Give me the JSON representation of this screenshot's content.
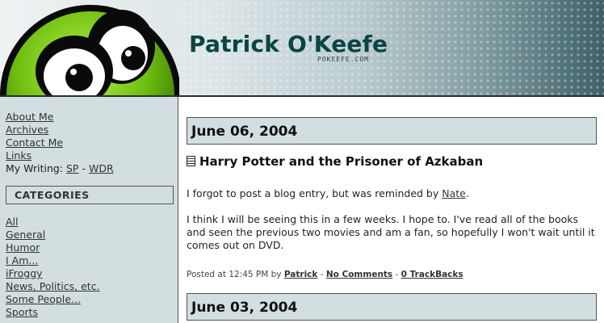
{
  "header": {
    "title": "Patrick O'Keefe",
    "domain": "POKEEFE.COM"
  },
  "sidebar": {
    "links": [
      {
        "label": "About Me"
      },
      {
        "label": "Archives"
      },
      {
        "label": "Contact Me"
      },
      {
        "label": "Links"
      }
    ],
    "writing": {
      "prefix": "My Writing:",
      "sp": "SP",
      "sep": "-",
      "wdr": "WDR"
    },
    "categories_heading": "CATEGORIES",
    "categories": [
      {
        "label": "All"
      },
      {
        "label": "General"
      },
      {
        "label": "Humor"
      },
      {
        "label": "I Am..."
      },
      {
        "label": "iFroggy"
      },
      {
        "label": "News, Politics, etc."
      },
      {
        "label": "Some People..."
      },
      {
        "label": "Sports"
      }
    ]
  },
  "main": {
    "dates": [
      "June 06, 2004",
      "June 03, 2004"
    ],
    "entry": {
      "title": "Harry Potter and the Prisoner of Azkaban",
      "para1_text": "I forgot to post a blog entry, but was reminded by ",
      "para1_link": "Nate",
      "para1_end": ".",
      "para2": "I think I will be seeing this in a few weeks. I hope to. I've read all of the books and seen the previous two movies and am a fan, so hopefully I won't wait until it comes out on DVD.",
      "meta_prefix": "Posted at 12:45 PM by ",
      "author": "Patrick",
      "comments": "No Comments",
      "trackbacks": "0 TrackBacks",
      "sep": " - "
    }
  },
  "colors": {
    "accent": "#0b4444",
    "panel": "#d2dee0"
  }
}
